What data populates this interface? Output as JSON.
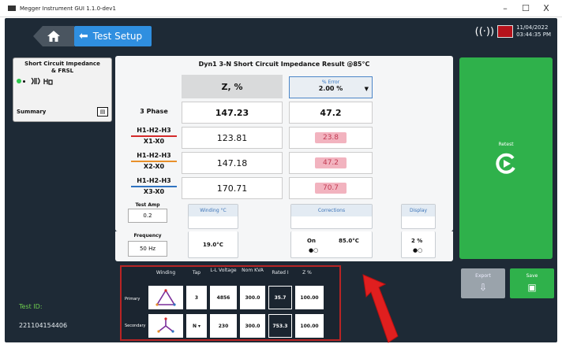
{
  "window": {
    "title": "Megger Instrument GUI 1.1.0-dev1",
    "minimize": "–",
    "maximize": "☐",
    "close": "X"
  },
  "header": {
    "back_label": "Test Setup",
    "home_icon": "home-icon",
    "back_icon": "arrow-left-icon"
  },
  "status": {
    "date": "11/04/2022",
    "time": "03:44:35 PM"
  },
  "side_card": {
    "title_line1": "Short Circuit Impedance",
    "title_line2": "& FRSL",
    "summary_label": "Summary"
  },
  "test_id": {
    "label": "Test ID:",
    "value": "221104154406"
  },
  "result": {
    "heading": "Dyn1 3-N Short Circuit Impedance Result @85°C",
    "col_z": "Z, %",
    "error_label": "% Error",
    "error_value": "2.00 %",
    "rows": [
      {
        "label_top": "3 Phase",
        "label_bottom": "",
        "z": "147.23",
        "err": "47.2",
        "highlight": false
      },
      {
        "label_top": "H1-H2-H3",
        "label_bottom": "X1-X0",
        "z": "123.81",
        "err": "23.8",
        "highlight": true,
        "line_color": "#d42a2a"
      },
      {
        "label_top": "H1-H2-H3",
        "label_bottom": "X2-X0",
        "z": "147.18",
        "err": "47.2",
        "highlight": true,
        "line_color": "#e8902a"
      },
      {
        "label_top": "H1-H2-H3",
        "label_bottom": "X3-X0",
        "z": "170.71",
        "err": "70.7",
        "highlight": true,
        "line_color": "#2f73c0"
      }
    ]
  },
  "test_amp": {
    "label": "Test Amp",
    "value": "0.2"
  },
  "frequency": {
    "label": "Frequency",
    "value": "50 Hz"
  },
  "winding_panel": {
    "title": "Winding °C",
    "value": "19.0°C"
  },
  "corrections_panel": {
    "title": "Corrections",
    "state": "On",
    "value": "85.0°C"
  },
  "display_panel": {
    "title": "Display",
    "value": "2 %"
  },
  "retest": {
    "label": "Retest"
  },
  "export": {
    "label": "Export"
  },
  "save": {
    "label": "Save"
  },
  "transformer": {
    "headers": {
      "winding": "Winding",
      "tap": "Tap",
      "voltage": "L-L Voltage",
      "kva": "Nom KVA",
      "rated": "Rated I",
      "z": "Z %"
    },
    "primary": {
      "label": "Primary",
      "tap": "3",
      "voltage": "4856",
      "kva": "300.0",
      "rated": "35.7",
      "z": "100.00"
    },
    "secondary": {
      "label": "Secondary",
      "tap": "N ▾",
      "voltage": "230",
      "kva": "300.0",
      "rated": "753.3",
      "z": "100.00"
    }
  }
}
